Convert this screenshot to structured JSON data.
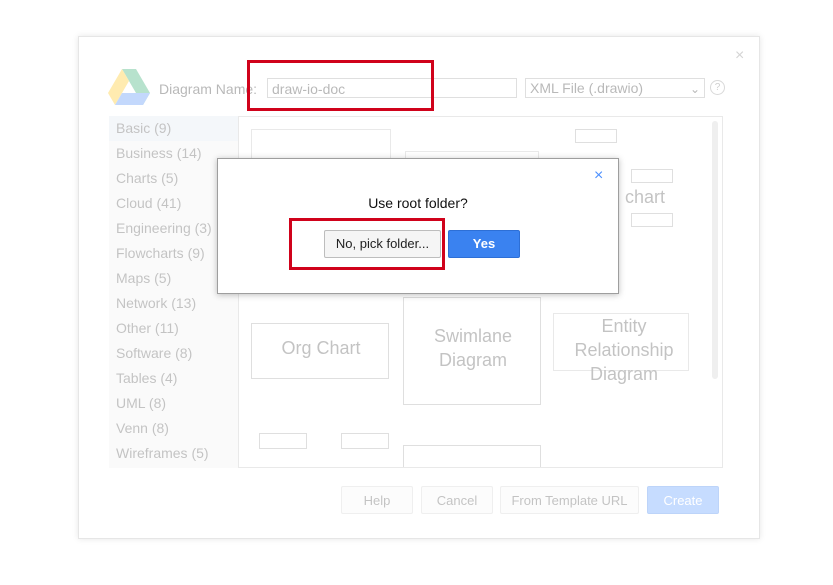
{
  "new_diagram_dialog": {
    "close_glyph": "×",
    "name_label": "Diagram Name:",
    "name_value": "draw-io-doc",
    "format_value": "XML File (.drawio)",
    "help_glyph": "?",
    "categories": [
      "Basic (9)",
      "Business (14)",
      "Charts (5)",
      "Cloud (41)",
      "Engineering (3)",
      "Flowcharts (9)",
      "Maps (5)",
      "Network (13)",
      "Other (11)",
      "Software (8)",
      "Tables (4)",
      "UML (8)",
      "Venn (8)",
      "Wireframes (5)"
    ],
    "templates": {
      "org_chart": "Org Chart",
      "swimlane": "Swimlane Diagram",
      "er": "Entity Relationship Diagram",
      "flowchart_partial": "chart"
    },
    "footer": {
      "help": "Help",
      "cancel": "Cancel",
      "from_template_url": "From Template URL",
      "create": "Create"
    }
  },
  "confirm_dialog": {
    "close_glyph": "×",
    "message": "Use root folder?",
    "no_button": "No, pick folder...",
    "yes_button": "Yes"
  },
  "colors": {
    "highlight": "#d0021b",
    "primary": "#3a82f0"
  },
  "icons": {
    "drive_logo": "google-drive-logo",
    "format_select_chevron": "chevron-down-icon",
    "help": "help-circle-icon"
  }
}
